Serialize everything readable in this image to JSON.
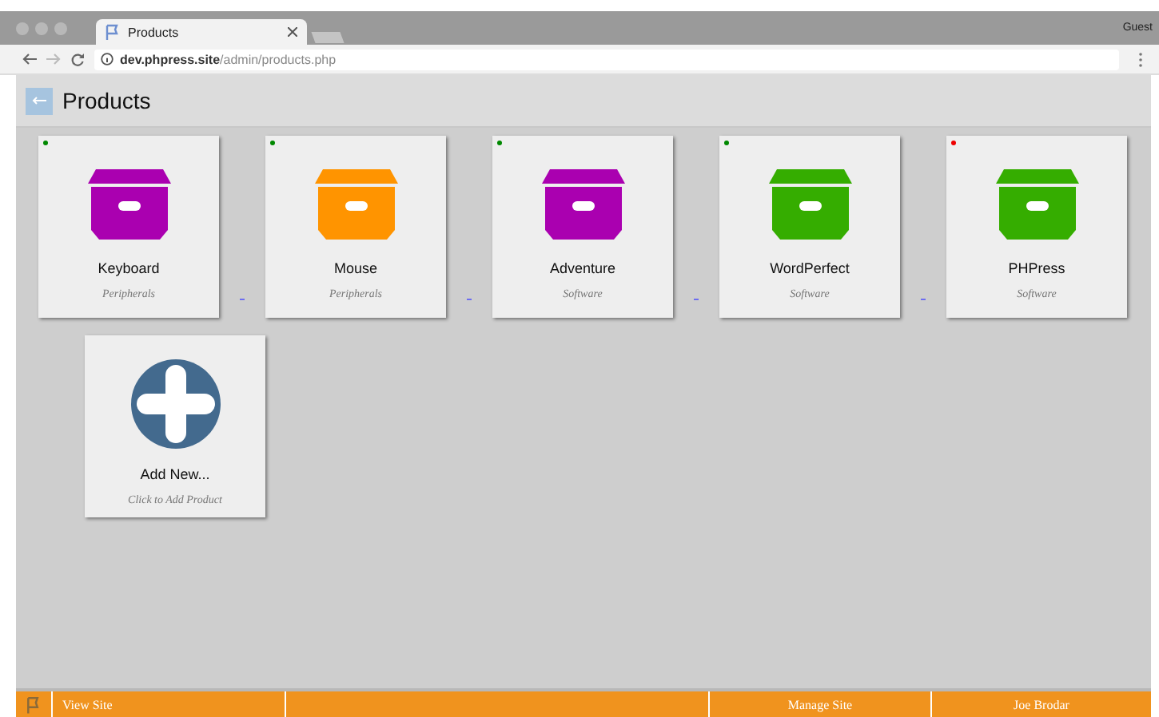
{
  "browser": {
    "tab_title": "Products",
    "profile": "Guest",
    "url_host": "dev.phpress.site",
    "url_path": "/admin/products.php"
  },
  "header": {
    "title": "Products"
  },
  "cards": [
    {
      "kind": "product",
      "name": "Keyboard",
      "category": "Peripherals",
      "icon": {
        "color": "#aa00b0"
      },
      "status_dot": {
        "color": "#008800"
      }
    },
    {
      "kind": "product",
      "name": "Mouse",
      "category": "Peripherals",
      "icon": {
        "color": "#ff9400"
      },
      "status_dot": {
        "color": "#008800"
      }
    },
    {
      "kind": "product",
      "name": "Adventure",
      "category": "Software",
      "icon": {
        "color": "#aa00b0"
      },
      "status_dot": {
        "color": "#008800"
      }
    },
    {
      "kind": "product",
      "name": "WordPerfect",
      "category": "Software",
      "icon": {
        "color": "#35ad00"
      },
      "status_dot": {
        "color": "#008800"
      }
    },
    {
      "kind": "product",
      "name": "PHPress",
      "category": "Software",
      "icon": {
        "color": "#35ad00"
      },
      "status_dot": {
        "color": "#ee0000"
      }
    },
    {
      "kind": "add",
      "name": "Add New...",
      "category": "Click to Add Product"
    }
  ],
  "footer": {
    "items": [
      {
        "kind": "link",
        "label": "View Site"
      },
      {
        "kind": "spacer"
      },
      {
        "kind": "link",
        "label": "Manage Site"
      },
      {
        "kind": "link",
        "label": "Joe Brodar"
      }
    ]
  }
}
